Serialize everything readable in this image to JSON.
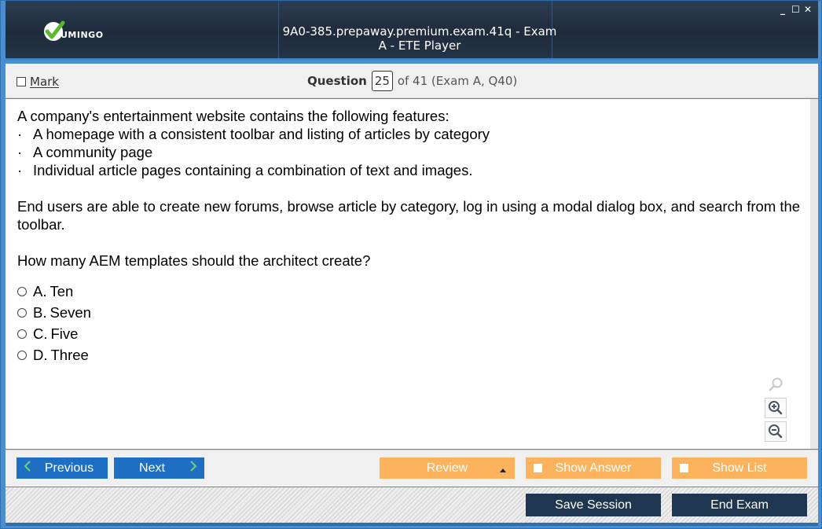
{
  "app": {
    "logo_text": "UMINGO",
    "title": "9A0-385.prepaway.premium.exam.41q - Exam A - ETE Player",
    "window_controls": {
      "minimize": "_",
      "maximize": "☐",
      "close": "✕"
    }
  },
  "question_bar": {
    "mark_label": "Mark",
    "question_label": "Question",
    "question_number": "25",
    "question_of": "of 41 (Exam A, Q40)"
  },
  "question": {
    "intro": "A company's entertainment website contains the following features:",
    "bullet_char": "·",
    "features": [
      "A homepage with a consistent toolbar and listing of articles by category",
      "A community page",
      "Individual article pages containing a combination of text and images."
    ],
    "paragraph": "End users are able to create new forums, browse article by category, log in using a modal dialog box, and search from the toolbar.",
    "prompt": "How many AEM templates should the architect create?",
    "options": [
      {
        "letter": "A.",
        "text": "Ten"
      },
      {
        "letter": "B.",
        "text": "Seven"
      },
      {
        "letter": "C.",
        "text": "Five"
      },
      {
        "letter": "D.",
        "text": "Three"
      }
    ]
  },
  "navigation": {
    "previous_label": "Previous",
    "next_label": "Next",
    "review_label": "Review",
    "show_answer_label": "Show Answer",
    "show_list_label": "Show List"
  },
  "footer": {
    "save_session_label": "Save Session",
    "end_exam_label": "End Exam"
  },
  "colors": {
    "titlebar": "#243446",
    "nav_blue": "#1e6fc4",
    "review_orange": "#fdb35d",
    "footer_dark": "#1f3650"
  }
}
